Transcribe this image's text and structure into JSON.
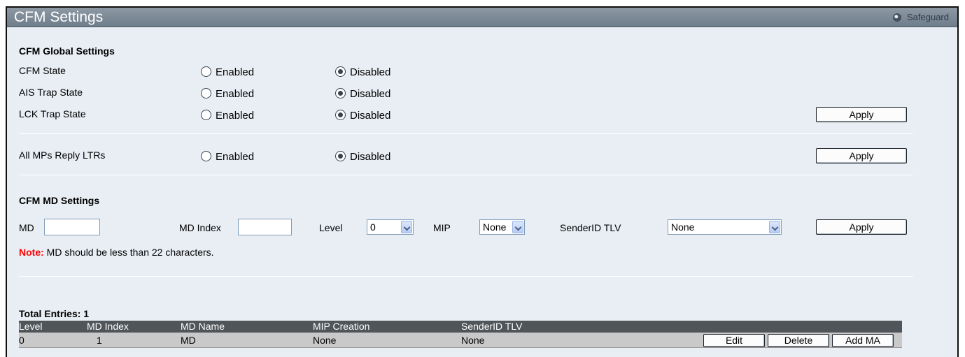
{
  "header": {
    "title": "CFM Settings",
    "safeguard": "Safeguard"
  },
  "global": {
    "section_title": "CFM Global Settings",
    "rows": [
      {
        "label": "CFM State",
        "enabled": "Enabled",
        "disabled": "Disabled",
        "selected": "Disabled"
      },
      {
        "label": "AIS Trap State",
        "enabled": "Enabled",
        "disabled": "Disabled",
        "selected": "Disabled"
      },
      {
        "label": "LCK Trap State",
        "enabled": "Enabled",
        "disabled": "Disabled",
        "selected": "Disabled"
      }
    ],
    "apply": "Apply"
  },
  "ltr": {
    "label": "All MPs Reply LTRs",
    "enabled": "Enabled",
    "disabled": "Disabled",
    "selected": "Disabled",
    "apply": "Apply"
  },
  "md": {
    "section_title": "CFM MD Settings",
    "md_label": "MD",
    "md_value": "",
    "md_index_label": "MD Index",
    "md_index_value": "",
    "level_label": "Level",
    "level_value": "0",
    "mip_label": "MIP",
    "mip_value": "None",
    "sender_label": "SenderID TLV",
    "sender_value": "None",
    "apply": "Apply",
    "note_prefix": "Note:",
    "note_text": "MD should be less than 22 characters."
  },
  "table": {
    "total_label": "Total Entries: 1",
    "columns": [
      "Level",
      "MD Index",
      "MD Name",
      "MIP Creation",
      "SenderID TLV"
    ],
    "rows": [
      {
        "level": "0",
        "md_index": "1",
        "md_name": "MD",
        "mip": "None",
        "sender": "None"
      }
    ],
    "edit": "Edit",
    "delete": "Delete",
    "add_ma": "Add MA"
  },
  "colors": {
    "title_bar": "#7d8a96",
    "panel": "#e9eef4",
    "note": "#ff0000",
    "table_header": "#4f5559",
    "table_row": "#c9c9c9"
  }
}
